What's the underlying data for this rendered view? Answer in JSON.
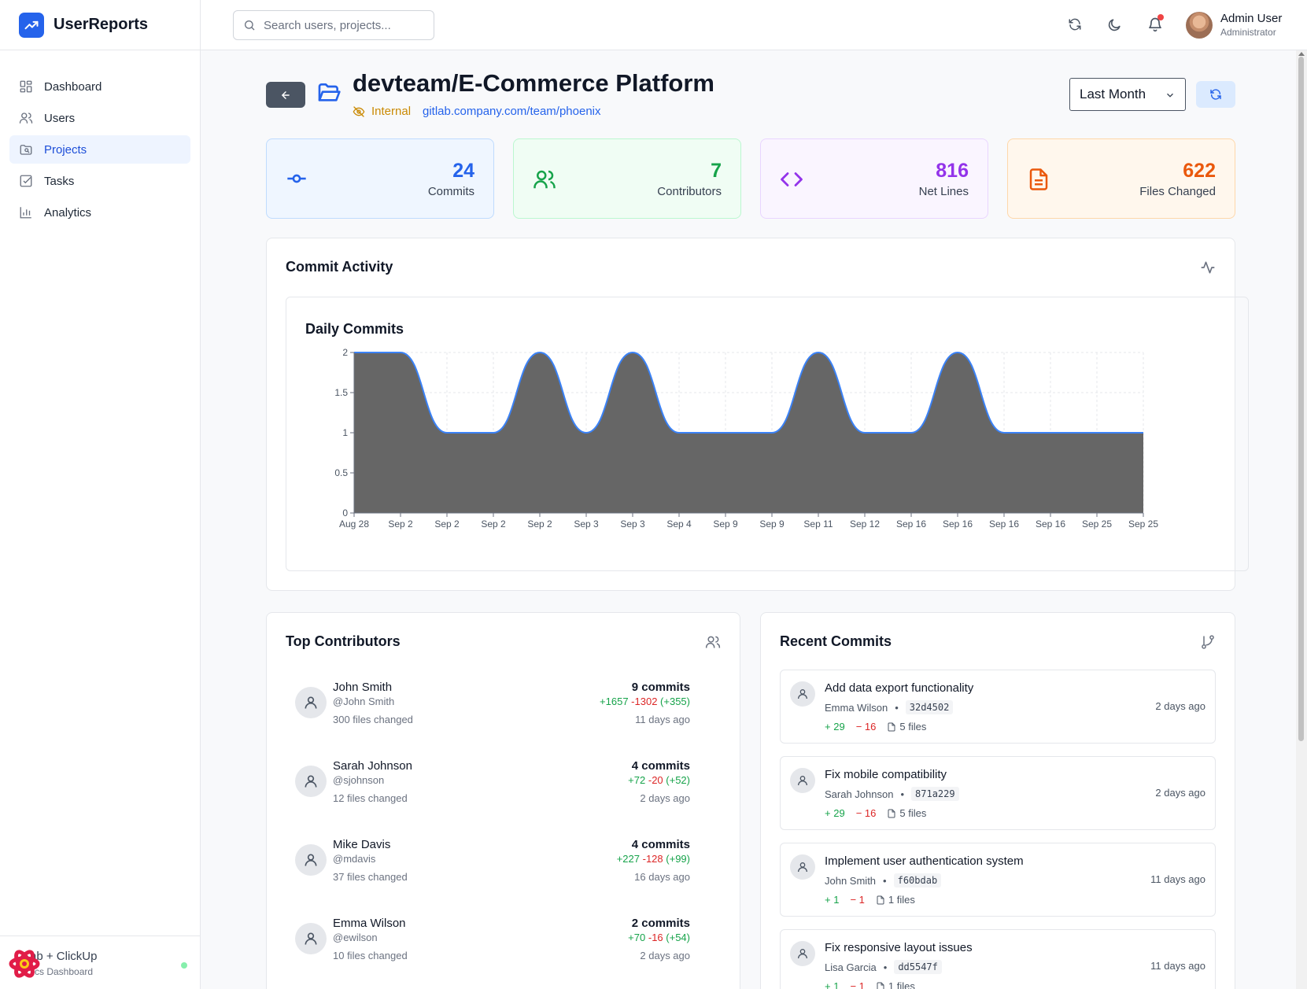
{
  "app": {
    "name": "UserReports"
  },
  "sidebar": {
    "items": [
      {
        "label": "Dashboard",
        "icon": "dashboard-icon"
      },
      {
        "label": "Users",
        "icon": "users-icon"
      },
      {
        "label": "Projects",
        "icon": "projects-icon",
        "active": true
      },
      {
        "label": "Tasks",
        "icon": "tasks-icon"
      },
      {
        "label": "Analytics",
        "icon": "analytics-icon"
      }
    ],
    "footer": {
      "title": "ab + ClickUp",
      "subtitle": "tics Dashboard"
    }
  },
  "header": {
    "search_placeholder": "Search users, projects...",
    "user": {
      "name": "Admin User",
      "role": "Administrator"
    }
  },
  "project": {
    "title": "devteam/E-Commerce Platform",
    "visibility": "Internal",
    "url": "gitlab.company.com/team/phoenix",
    "period": "Last Month"
  },
  "stats": [
    {
      "value": "24",
      "label": "Commits",
      "color": "#2563eb"
    },
    {
      "value": "7",
      "label": "Contributors",
      "color": "#16a34a"
    },
    {
      "value": "816",
      "label": "Net Lines",
      "color": "#9333ea"
    },
    {
      "value": "622",
      "label": "Files Changed",
      "color": "#ea580c"
    }
  ],
  "activity": {
    "title": "Commit Activity",
    "chart_title": "Daily Commits"
  },
  "chart_data": {
    "type": "area",
    "title": "Daily Commits",
    "x": [
      "Aug 28",
      "Sep 2",
      "Sep 2",
      "Sep 2",
      "Sep 2",
      "Sep 3",
      "Sep 3",
      "Sep 4",
      "Sep 9",
      "Sep 9",
      "Sep 11",
      "Sep 12",
      "Sep 16",
      "Sep 16",
      "Sep 16",
      "Sep 16",
      "Sep 25",
      "Sep 25"
    ],
    "values": [
      2,
      2,
      1,
      1,
      2,
      1,
      2,
      1,
      1,
      1,
      2,
      1,
      1,
      2,
      1,
      1,
      1,
      1
    ],
    "y_ticks": [
      "0",
      "0.5",
      "1",
      "1.5",
      "2"
    ],
    "ylim": [
      0,
      2
    ],
    "grid": true,
    "colors": {
      "fill": "#666666",
      "stroke": "#3b82f6"
    }
  },
  "contributors": {
    "title": "Top Contributors",
    "items": [
      {
        "name": "John Smith",
        "handle": "@John Smith",
        "files": "300 files changed",
        "commits": "9 commits",
        "added": "+1657",
        "removed": "-1302",
        "net": "(+355)",
        "ago": "11 days ago"
      },
      {
        "name": "Sarah Johnson",
        "handle": "@sjohnson",
        "files": "12 files changed",
        "commits": "4 commits",
        "added": "+72",
        "removed": "-20",
        "net": "(+52)",
        "ago": "2 days ago"
      },
      {
        "name": "Mike Davis",
        "handle": "@mdavis",
        "files": "37 files changed",
        "commits": "4 commits",
        "added": "+227",
        "removed": "-128",
        "net": "(+99)",
        "ago": "16 days ago"
      },
      {
        "name": "Emma Wilson",
        "handle": "@ewilson",
        "files": "10 files changed",
        "commits": "2 commits",
        "added": "+70",
        "removed": "-16",
        "net": "(+54)",
        "ago": "2 days ago"
      }
    ]
  },
  "commits": {
    "title": "Recent Commits",
    "items": [
      {
        "message": "Add data export functionality",
        "author": "Emma Wilson",
        "hash": "32d4502",
        "added": "29",
        "removed": "16",
        "files": "5 files",
        "ago": "2 days ago"
      },
      {
        "message": "Fix mobile compatibility",
        "author": "Sarah Johnson",
        "hash": "871a229",
        "added": "29",
        "removed": "16",
        "files": "5 files",
        "ago": "2 days ago"
      },
      {
        "message": "Implement user authentication system",
        "author": "John Smith",
        "hash": "f60bdab",
        "added": "1",
        "removed": "1",
        "files": "1 files",
        "ago": "11 days ago"
      },
      {
        "message": "Fix responsive layout issues",
        "author": "Lisa Garcia",
        "hash": "dd5547f",
        "added": "1",
        "removed": "1",
        "files": "1 files",
        "ago": "11 days ago"
      }
    ]
  }
}
